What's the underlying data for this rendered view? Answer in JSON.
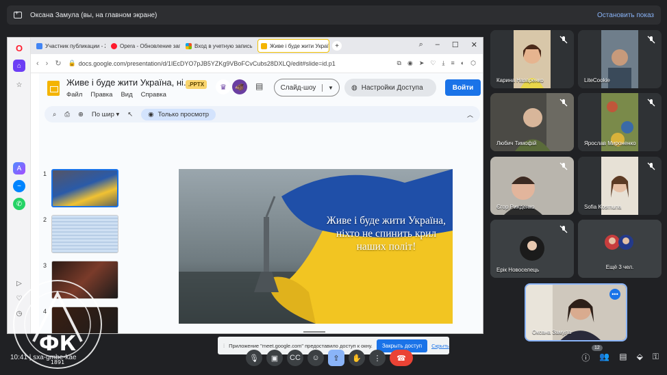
{
  "presenting": {
    "label": "Оксана Замула (вы, на главном экране)",
    "stop_label": "Остановить показ"
  },
  "browser": {
    "tabs": [
      {
        "label": "Участник публикации - 2",
        "color": "#4285f4"
      },
      {
        "label": "Opera - Обновление зап",
        "color": "#ff1b2d"
      },
      {
        "label": "Вход в учетную запись",
        "color": "#00a4ef"
      },
      {
        "label": "Живе і буде жити Украї",
        "color": "#f4b400"
      }
    ],
    "url": "docs.google.com/presentation/d/1IEcDYO7pJB5YZKg9VBoFCvCubs28DXLQ/edit#slide=id.p1"
  },
  "slides": {
    "title": "Живе і буде жити Україна, ні...",
    "badge": ".PPTX",
    "menu": [
      "Файл",
      "Правка",
      "Вид",
      "Справка"
    ],
    "slideshow_label": "Слайд-шоу",
    "access_label": "Настройки Доступа",
    "login_label": "Войти",
    "zoom_label": "По шир",
    "view_mode_label": "Только просмотр",
    "slide_numbers": [
      "1",
      "2",
      "3",
      "4"
    ],
    "slide_text": "Живе і буде жити Україна, ніхто не спинить крил наших політ!"
  },
  "participants": [
    {
      "name": "Карина Назаренко"
    },
    {
      "name": "LiteCookie"
    },
    {
      "name": "Любич Тимофій"
    },
    {
      "name": "Ярослав Мироненко"
    },
    {
      "name": "Єгор Ринденко"
    },
    {
      "name": "Sofia Kosmuna"
    },
    {
      "name": "Ерік Новоселець"
    },
    {
      "name": "Ещё 3 чел."
    },
    {
      "name": "Оксана Замула"
    }
  ],
  "meeting": {
    "time": "10:41",
    "code": "sxa-gmbe-kae",
    "people_count": "12"
  },
  "share_toast": {
    "message": "Приложение \"meet.google.com\" предоставило доступ к окну.",
    "close_label": "Закрыть доступ",
    "hide_label": "Скрыть"
  },
  "watermark": {
    "letters": "ФК",
    "year": "1891",
    "ring_text": "НАУКОВИЙ ФАХОВИЙ КОЛЕДЖ"
  }
}
